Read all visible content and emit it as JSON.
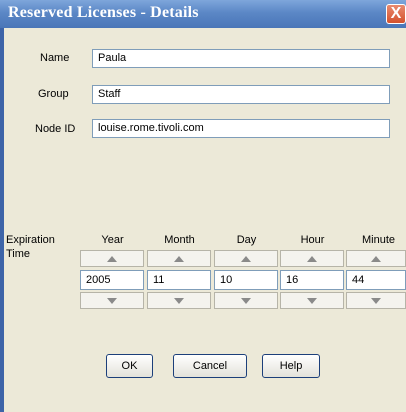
{
  "window": {
    "title": "Reserved Licenses - Details",
    "close": "X"
  },
  "form": {
    "name": {
      "label": "Name",
      "value": "Paula"
    },
    "group": {
      "label": "Group",
      "value": "Staff"
    },
    "node_id": {
      "label": "Node ID",
      "value": "louise.rome.tivoli.com"
    }
  },
  "expiration": {
    "label_line1": "Expiration",
    "label_line2": "Time",
    "columns": [
      {
        "header": "Year",
        "value": "2005"
      },
      {
        "header": "Month",
        "value": "11"
      },
      {
        "header": "Day",
        "value": "10"
      },
      {
        "header": "Hour",
        "value": "16"
      },
      {
        "header": "Minute",
        "value": "44"
      }
    ]
  },
  "buttons": {
    "ok": "OK",
    "cancel": "Cancel",
    "help": "Help"
  }
}
